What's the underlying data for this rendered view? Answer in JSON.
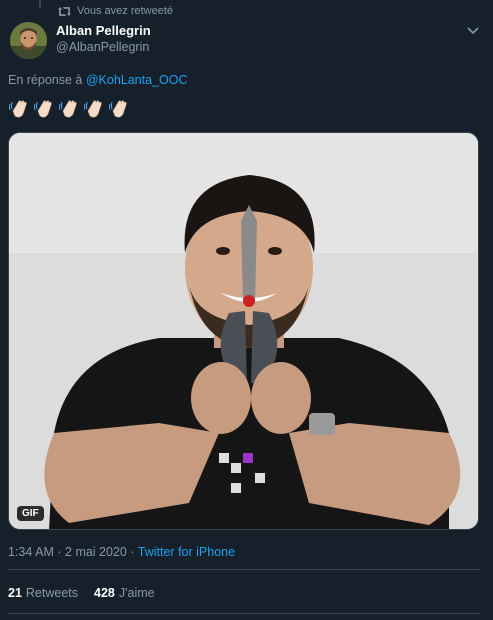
{
  "retweet_notice": "Vous avez retweeté",
  "tweet": {
    "display_name": "Alban Pellegrin",
    "handle": "@AlbanPellegrin",
    "reply_prefix": "En réponse à",
    "reply_to": "@KohLanta_OOC",
    "emoji": [
      "clapping-hands",
      "clapping-hands",
      "clapping-hands",
      "clapping-hands",
      "clapping-hands"
    ],
    "media_badge": "GIF",
    "time": "1:34 AM",
    "separator": "·",
    "date": "2 mai 2020",
    "source": "Twitter for iPhone",
    "retweets_count": "21",
    "retweets_label": "Retweets",
    "likes_count": "428",
    "likes_label": "J'aime"
  },
  "colors": {
    "background": "#15202b",
    "link": "#1da1f2",
    "muted": "#8899a6",
    "divider": "#38444d"
  }
}
